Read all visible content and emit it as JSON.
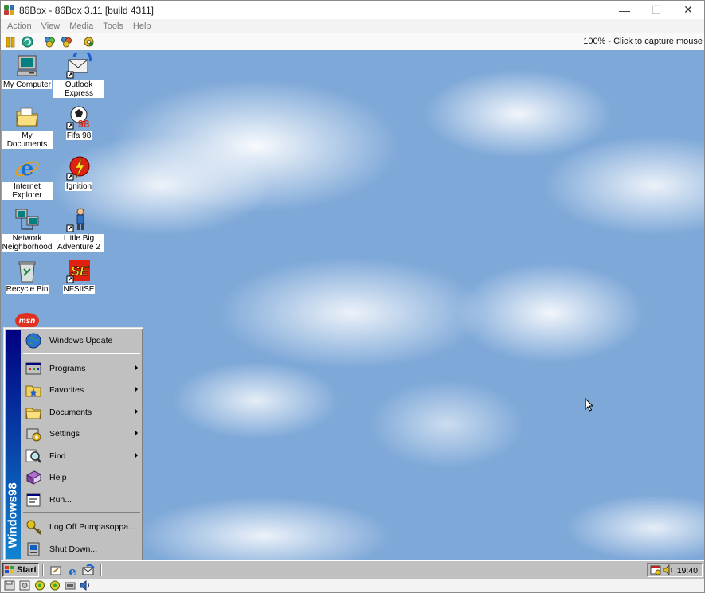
{
  "window": {
    "title": "86Box - 86Box 3.11 [build 4311]",
    "controls": {
      "minimize": "—",
      "maximize": "☐",
      "close": "✕"
    }
  },
  "menubar": [
    "Action",
    "View",
    "Media",
    "Tools",
    "Help"
  ],
  "toolbar": {
    "buttons": [
      "pause-icon",
      "reset-icon",
      "ctrl-alt-del-icon",
      "ctrl-alt-esc-icon",
      "settings-icon"
    ],
    "capture_status": "100% - Click to capture mouse"
  },
  "desktop": {
    "icons": [
      {
        "label": "My Computer",
        "icon": "my-computer-icon"
      },
      {
        "label": "Outlook Express",
        "icon": "outlook-express-icon"
      },
      {
        "label": "My Documents",
        "icon": "my-documents-icon"
      },
      {
        "label": "Fifa 98",
        "icon": "fifa-98-icon"
      },
      {
        "label": "Internet Explorer",
        "icon": "internet-explorer-icon"
      },
      {
        "label": "Ignition",
        "icon": "ignition-icon"
      },
      {
        "label": "Network Neighborhood",
        "icon": "network-neighborhood-icon"
      },
      {
        "label": "Little Big Adventure 2",
        "icon": "little-big-adventure-2-icon"
      },
      {
        "label": "Recycle Bin",
        "icon": "recycle-bin-icon"
      },
      {
        "label": "NFSIISE",
        "icon": "nfsiise-icon"
      },
      {
        "label": "",
        "icon": "msn-icon",
        "logo_text": "msn"
      }
    ]
  },
  "start_menu": {
    "banner": "Windows98",
    "items": [
      {
        "label": "Windows Update",
        "icon": "windows-update-icon",
        "submenu": false
      },
      {
        "label": "Programs",
        "icon": "programs-icon",
        "submenu": true
      },
      {
        "label": "Favorites",
        "icon": "favorites-icon",
        "submenu": true
      },
      {
        "label": "Documents",
        "icon": "documents-icon",
        "submenu": true
      },
      {
        "label": "Settings",
        "icon": "settings-icon",
        "submenu": true
      },
      {
        "label": "Find",
        "icon": "find-icon",
        "submenu": true
      },
      {
        "label": "Help",
        "icon": "help-icon",
        "submenu": false
      },
      {
        "label": "Run...",
        "icon": "run-icon",
        "submenu": false
      },
      {
        "label": "Log Off Pumpasoppa...",
        "icon": "log-off-icon",
        "submenu": false
      },
      {
        "label": "Shut Down...",
        "icon": "shut-down-icon",
        "submenu": false
      }
    ]
  },
  "taskbar": {
    "start_label": "Start",
    "quick_launch": [
      "show-desktop-icon",
      "internet-explorer-icon",
      "outlook-express-icon"
    ],
    "clock": "19:40",
    "tray": [
      "scheduler-icon",
      "volume-icon"
    ]
  },
  "statusbar": {
    "icons": [
      "floppy-drive-icon",
      "cdrom-drive-icon",
      "hard-disk-activity-icon",
      "hard-disk-activity-icon",
      "network-icon",
      "sound-icon"
    ]
  },
  "colors": {
    "desktop_sky": "#7ea8d8",
    "win98_face": "#c0c0c0",
    "start_banner_top": "#000080",
    "start_banner_bottom": "#1084d0"
  }
}
